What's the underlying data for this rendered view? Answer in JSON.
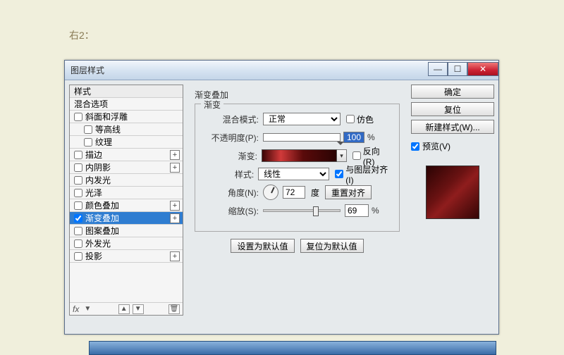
{
  "page_label": "右2：",
  "dialog_title": "图层样式",
  "left": {
    "styles_header": "样式",
    "blend_options": "混合选项",
    "bevel": "斜面和浮雕",
    "contour": "等高线",
    "texture": "纹理",
    "stroke": "描边",
    "inner_shadow": "内阴影",
    "inner_glow": "内发光",
    "satin": "光泽",
    "color_overlay": "颜色叠加",
    "gradient_overlay": "渐变叠加",
    "pattern_overlay": "图案叠加",
    "outer_glow": "外发光",
    "drop_shadow": "投影",
    "fx_label": "fx"
  },
  "main": {
    "panel_title": "渐变叠加",
    "group_legend": "渐变",
    "blend_mode_label": "混合模式:",
    "blend_mode_value": "正常",
    "dither": "仿色",
    "opacity_label": "不透明度(P):",
    "opacity_value": "100",
    "gradient_label": "渐变:",
    "reverse": "反向(R)",
    "style_label": "样式:",
    "style_value": "线性",
    "align_layer": "与图层对齐(I)",
    "angle_label": "角度(N):",
    "angle_value": "72",
    "angle_unit": "度",
    "reset_align": "重置对齐",
    "scale_label": "缩放(S):",
    "scale_value": "69",
    "percent": "%",
    "set_default": "设置为默认值",
    "reset_default": "复位为默认值"
  },
  "right": {
    "ok": "确定",
    "cancel": "复位",
    "new_style": "新建样式(W)...",
    "preview": "预览(V)"
  },
  "icons": {
    "plus": "+",
    "trash": "🗑",
    "up": "▲",
    "down": "▼",
    "drop": "▾",
    "min": "—",
    "max": "☐",
    "close": "✕"
  }
}
